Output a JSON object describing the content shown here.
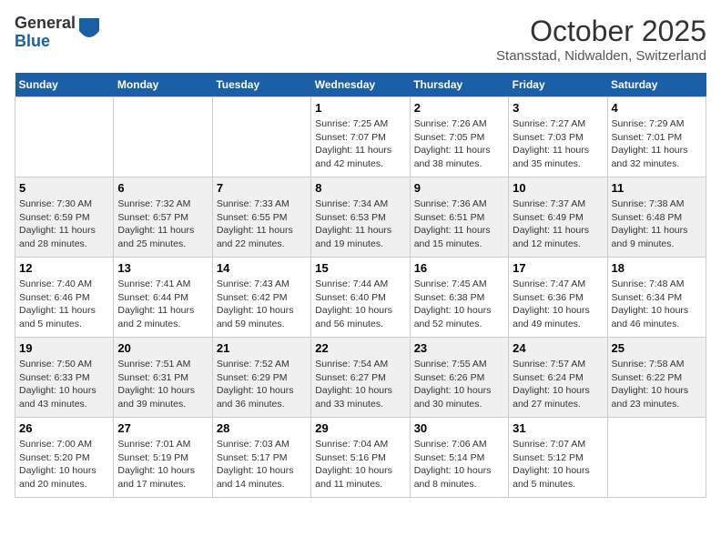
{
  "header": {
    "logo_general": "General",
    "logo_blue": "Blue",
    "month_title": "October 2025",
    "location": "Stansstad, Nidwalden, Switzerland"
  },
  "weekdays": [
    "Sunday",
    "Monday",
    "Tuesday",
    "Wednesday",
    "Thursday",
    "Friday",
    "Saturday"
  ],
  "weeks": [
    [
      {
        "day": "",
        "sunrise": "",
        "sunset": "",
        "daylight": ""
      },
      {
        "day": "",
        "sunrise": "",
        "sunset": "",
        "daylight": ""
      },
      {
        "day": "",
        "sunrise": "",
        "sunset": "",
        "daylight": ""
      },
      {
        "day": "1",
        "sunrise": "Sunrise: 7:25 AM",
        "sunset": "Sunset: 7:07 PM",
        "daylight": "Daylight: 11 hours and 42 minutes."
      },
      {
        "day": "2",
        "sunrise": "Sunrise: 7:26 AM",
        "sunset": "Sunset: 7:05 PM",
        "daylight": "Daylight: 11 hours and 38 minutes."
      },
      {
        "day": "3",
        "sunrise": "Sunrise: 7:27 AM",
        "sunset": "Sunset: 7:03 PM",
        "daylight": "Daylight: 11 hours and 35 minutes."
      },
      {
        "day": "4",
        "sunrise": "Sunrise: 7:29 AM",
        "sunset": "Sunset: 7:01 PM",
        "daylight": "Daylight: 11 hours and 32 minutes."
      }
    ],
    [
      {
        "day": "5",
        "sunrise": "Sunrise: 7:30 AM",
        "sunset": "Sunset: 6:59 PM",
        "daylight": "Daylight: 11 hours and 28 minutes."
      },
      {
        "day": "6",
        "sunrise": "Sunrise: 7:32 AM",
        "sunset": "Sunset: 6:57 PM",
        "daylight": "Daylight: 11 hours and 25 minutes."
      },
      {
        "day": "7",
        "sunrise": "Sunrise: 7:33 AM",
        "sunset": "Sunset: 6:55 PM",
        "daylight": "Daylight: 11 hours and 22 minutes."
      },
      {
        "day": "8",
        "sunrise": "Sunrise: 7:34 AM",
        "sunset": "Sunset: 6:53 PM",
        "daylight": "Daylight: 11 hours and 19 minutes."
      },
      {
        "day": "9",
        "sunrise": "Sunrise: 7:36 AM",
        "sunset": "Sunset: 6:51 PM",
        "daylight": "Daylight: 11 hours and 15 minutes."
      },
      {
        "day": "10",
        "sunrise": "Sunrise: 7:37 AM",
        "sunset": "Sunset: 6:49 PM",
        "daylight": "Daylight: 11 hours and 12 minutes."
      },
      {
        "day": "11",
        "sunrise": "Sunrise: 7:38 AM",
        "sunset": "Sunset: 6:48 PM",
        "daylight": "Daylight: 11 hours and 9 minutes."
      }
    ],
    [
      {
        "day": "12",
        "sunrise": "Sunrise: 7:40 AM",
        "sunset": "Sunset: 6:46 PM",
        "daylight": "Daylight: 11 hours and 5 minutes."
      },
      {
        "day": "13",
        "sunrise": "Sunrise: 7:41 AM",
        "sunset": "Sunset: 6:44 PM",
        "daylight": "Daylight: 11 hours and 2 minutes."
      },
      {
        "day": "14",
        "sunrise": "Sunrise: 7:43 AM",
        "sunset": "Sunset: 6:42 PM",
        "daylight": "Daylight: 10 hours and 59 minutes."
      },
      {
        "day": "15",
        "sunrise": "Sunrise: 7:44 AM",
        "sunset": "Sunset: 6:40 PM",
        "daylight": "Daylight: 10 hours and 56 minutes."
      },
      {
        "day": "16",
        "sunrise": "Sunrise: 7:45 AM",
        "sunset": "Sunset: 6:38 PM",
        "daylight": "Daylight: 10 hours and 52 minutes."
      },
      {
        "day": "17",
        "sunrise": "Sunrise: 7:47 AM",
        "sunset": "Sunset: 6:36 PM",
        "daylight": "Daylight: 10 hours and 49 minutes."
      },
      {
        "day": "18",
        "sunrise": "Sunrise: 7:48 AM",
        "sunset": "Sunset: 6:34 PM",
        "daylight": "Daylight: 10 hours and 46 minutes."
      }
    ],
    [
      {
        "day": "19",
        "sunrise": "Sunrise: 7:50 AM",
        "sunset": "Sunset: 6:33 PM",
        "daylight": "Daylight: 10 hours and 43 minutes."
      },
      {
        "day": "20",
        "sunrise": "Sunrise: 7:51 AM",
        "sunset": "Sunset: 6:31 PM",
        "daylight": "Daylight: 10 hours and 39 minutes."
      },
      {
        "day": "21",
        "sunrise": "Sunrise: 7:52 AM",
        "sunset": "Sunset: 6:29 PM",
        "daylight": "Daylight: 10 hours and 36 minutes."
      },
      {
        "day": "22",
        "sunrise": "Sunrise: 7:54 AM",
        "sunset": "Sunset: 6:27 PM",
        "daylight": "Daylight: 10 hours and 33 minutes."
      },
      {
        "day": "23",
        "sunrise": "Sunrise: 7:55 AM",
        "sunset": "Sunset: 6:26 PM",
        "daylight": "Daylight: 10 hours and 30 minutes."
      },
      {
        "day": "24",
        "sunrise": "Sunrise: 7:57 AM",
        "sunset": "Sunset: 6:24 PM",
        "daylight": "Daylight: 10 hours and 27 minutes."
      },
      {
        "day": "25",
        "sunrise": "Sunrise: 7:58 AM",
        "sunset": "Sunset: 6:22 PM",
        "daylight": "Daylight: 10 hours and 23 minutes."
      }
    ],
    [
      {
        "day": "26",
        "sunrise": "Sunrise: 7:00 AM",
        "sunset": "Sunset: 5:20 PM",
        "daylight": "Daylight: 10 hours and 20 minutes."
      },
      {
        "day": "27",
        "sunrise": "Sunrise: 7:01 AM",
        "sunset": "Sunset: 5:19 PM",
        "daylight": "Daylight: 10 hours and 17 minutes."
      },
      {
        "day": "28",
        "sunrise": "Sunrise: 7:03 AM",
        "sunset": "Sunset: 5:17 PM",
        "daylight": "Daylight: 10 hours and 14 minutes."
      },
      {
        "day": "29",
        "sunrise": "Sunrise: 7:04 AM",
        "sunset": "Sunset: 5:16 PM",
        "daylight": "Daylight: 10 hours and 11 minutes."
      },
      {
        "day": "30",
        "sunrise": "Sunrise: 7:06 AM",
        "sunset": "Sunset: 5:14 PM",
        "daylight": "Daylight: 10 hours and 8 minutes."
      },
      {
        "day": "31",
        "sunrise": "Sunrise: 7:07 AM",
        "sunset": "Sunset: 5:12 PM",
        "daylight": "Daylight: 10 hours and 5 minutes."
      },
      {
        "day": "",
        "sunrise": "",
        "sunset": "",
        "daylight": ""
      }
    ]
  ]
}
